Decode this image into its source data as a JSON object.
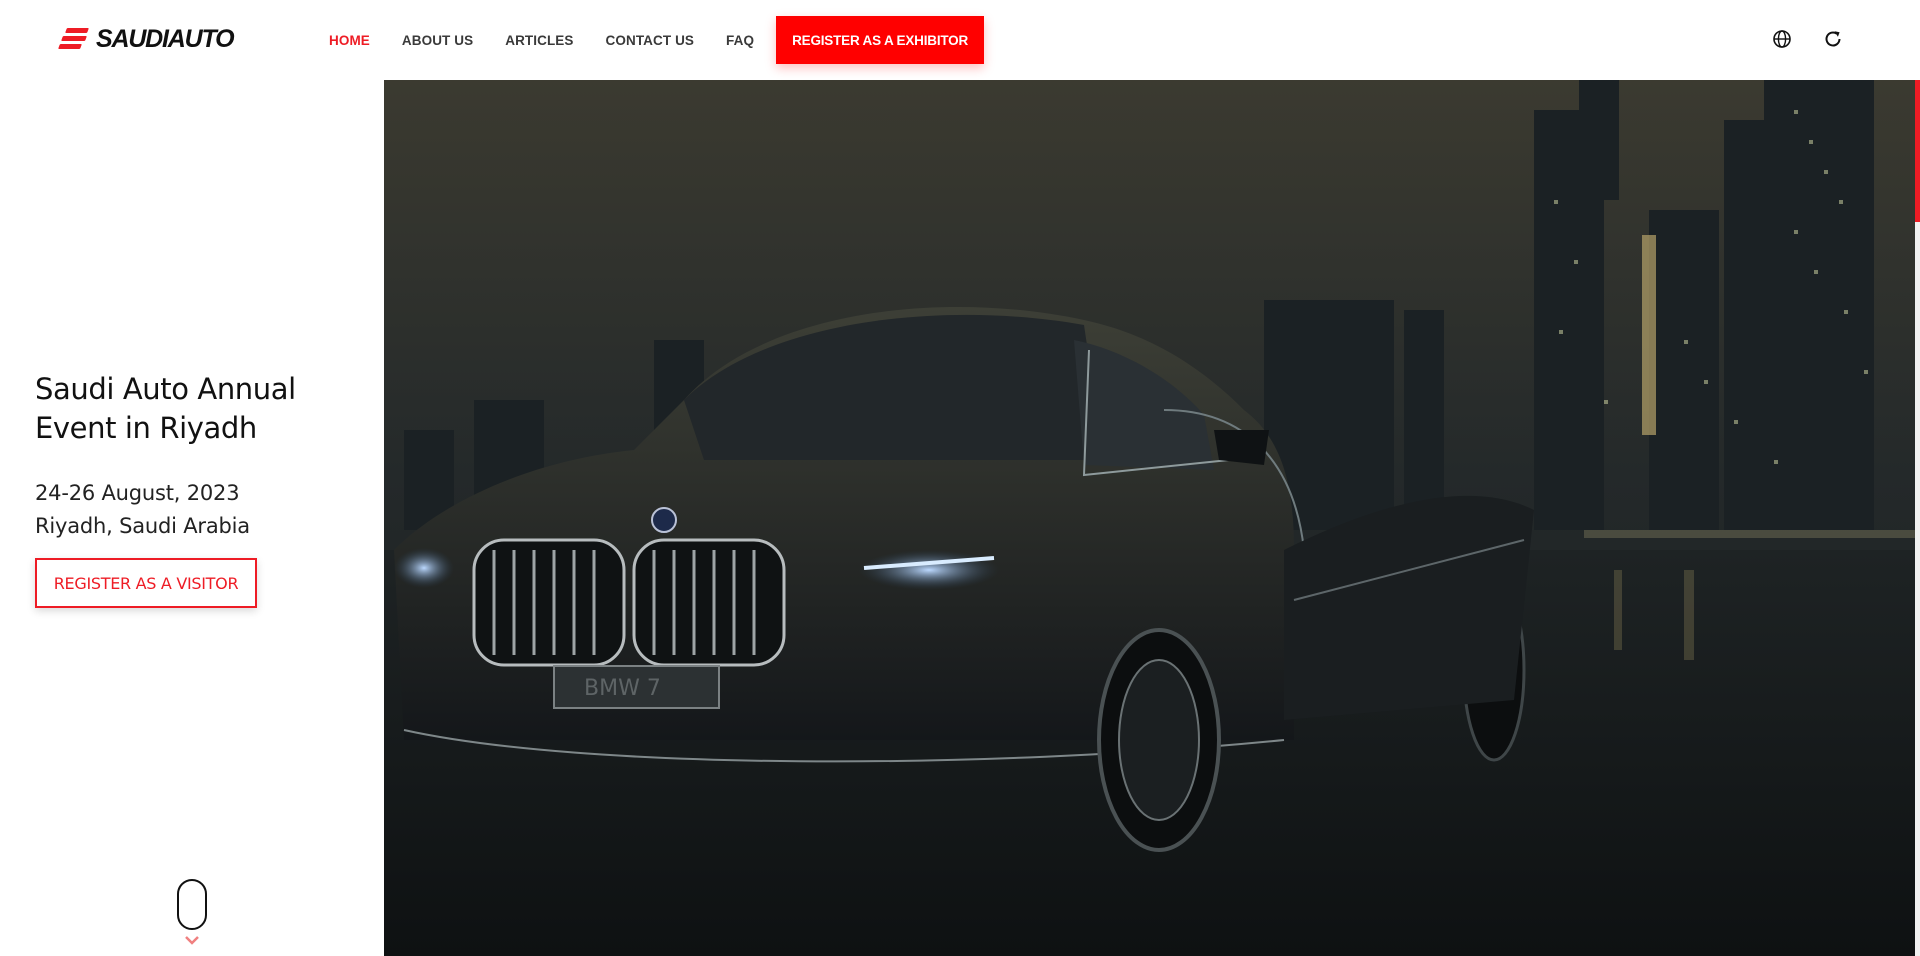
{
  "brand": {
    "name": "SAUDIAUTO",
    "accent": "#ee1c25"
  },
  "nav": {
    "items": [
      {
        "label": "HOME",
        "active": true
      },
      {
        "label": "ABOUT US",
        "active": false
      },
      {
        "label": "ARTICLES",
        "active": false
      },
      {
        "label": "CONTACT US",
        "active": false
      },
      {
        "label": "FAQ",
        "active": false
      }
    ],
    "cta_label": "REGISTER AS A EXHIBITOR",
    "icons": [
      "globe-icon",
      "refresh-icon"
    ]
  },
  "hero": {
    "title_line1": "Saudi Auto Annual",
    "title_line2": "Event in Riyadh",
    "date": "24-26 August, 2023",
    "location": "Riyadh, Saudi Arabia",
    "visitor_cta": "REGISTER AS A VISITOR",
    "image_plate_text": "BMW 7"
  }
}
